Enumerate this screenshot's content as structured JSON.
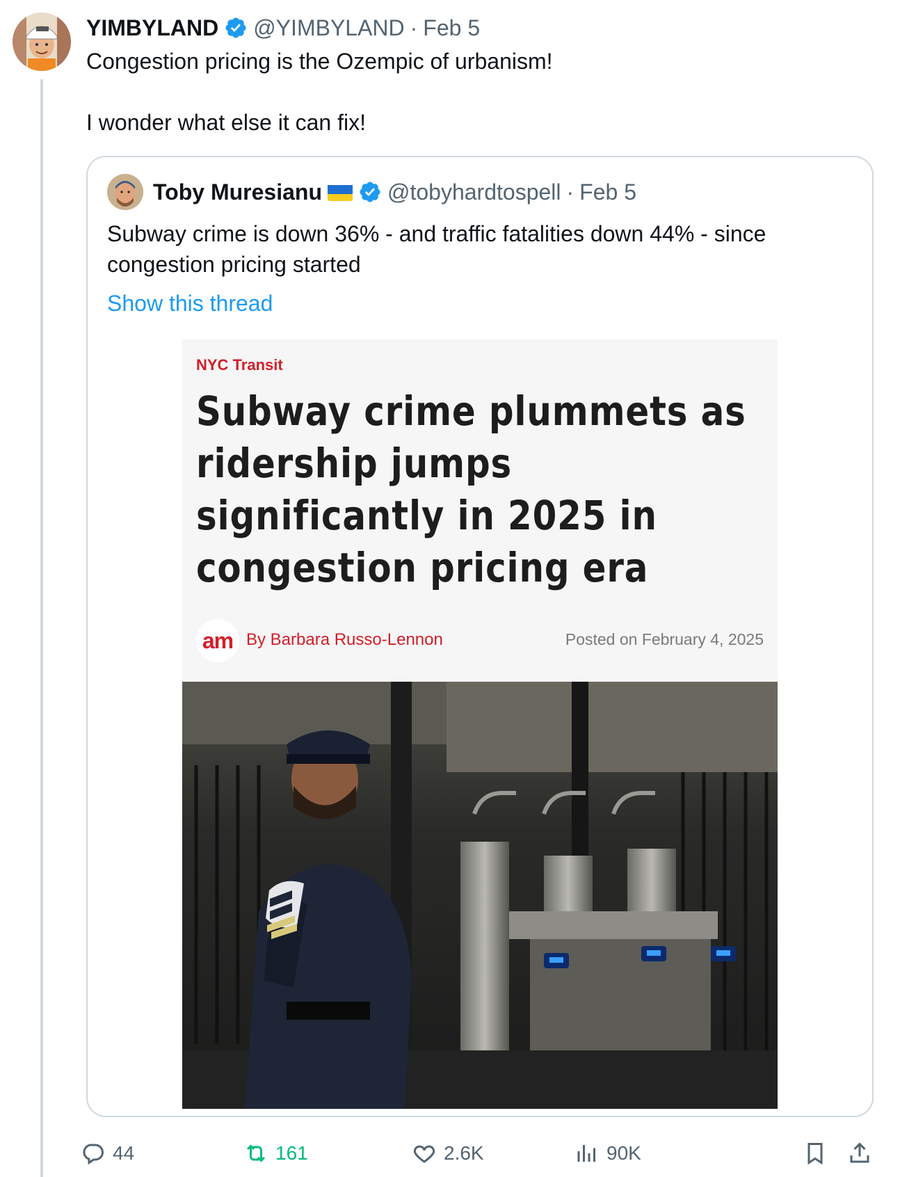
{
  "tweet": {
    "author_name": "YIMBYLAND",
    "handle": "@YIMBYLAND",
    "separator": "·",
    "date": "Feb 5",
    "text_line1": "Congestion pricing is the Ozempic of urbanism!",
    "text_line2": "I wonder what else it can fix!"
  },
  "quoted": {
    "author_name": "Toby Muresianu",
    "handle": "@tobyhardtospell",
    "separator": "·",
    "date": "Feb 5",
    "text": "Subway crime is down 36% - and traffic fatalities down 44% - since congestion pricing started",
    "show_thread": "Show this thread",
    "article": {
      "kicker": "NYC Transit",
      "headline_lines": [
        "Subway crime plummets as",
        "ridership jumps",
        "significantly in 2025 in",
        "congestion pricing era"
      ],
      "logo_text": "am",
      "byline": "By Barbara Russo-Lennon",
      "posted": "Posted on February 4, 2025"
    }
  },
  "actions": {
    "replies": "44",
    "reposts": "161",
    "likes": "2.6K",
    "views": "90K"
  },
  "colors": {
    "accent_blue": "#1d9bf0",
    "repost_green": "#00ba7c",
    "muted": "#536471",
    "article_red": "#d11f2a"
  }
}
